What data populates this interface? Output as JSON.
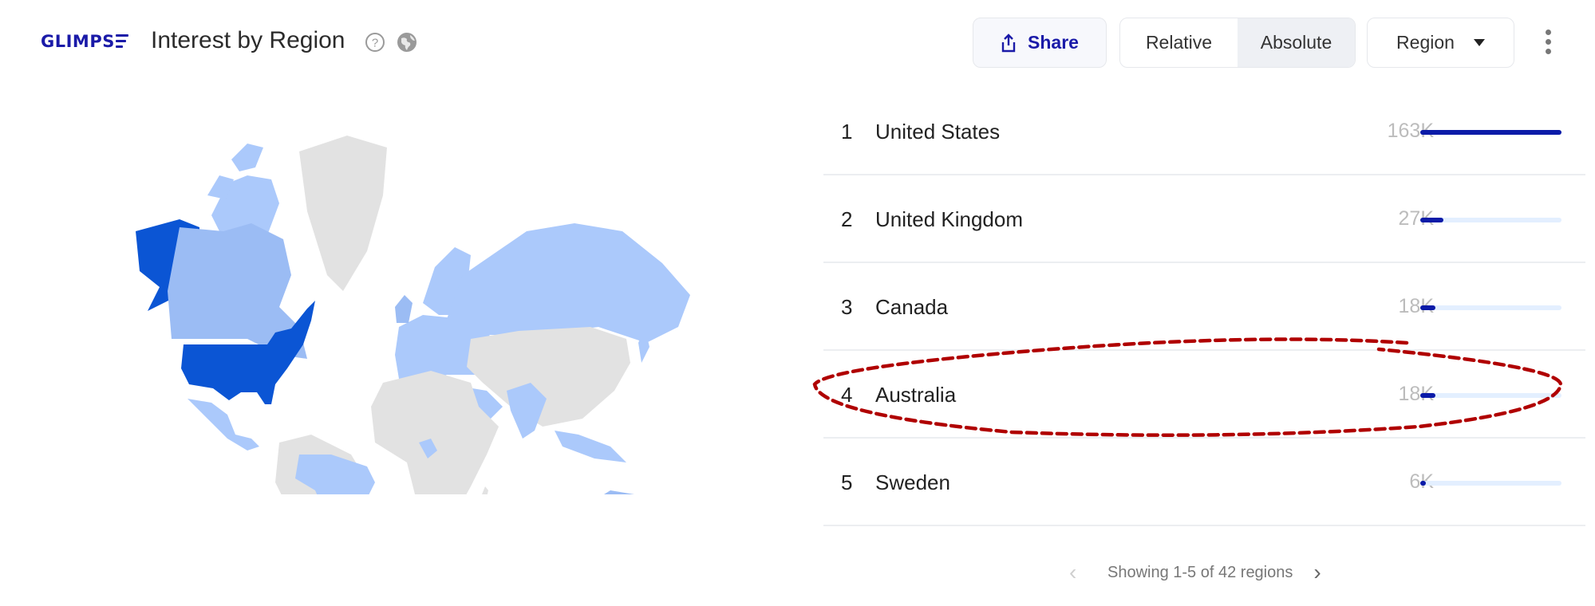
{
  "header": {
    "logo": "GLIMPS",
    "title": "Interest by Region",
    "icons": {
      "help": "help-circle-icon",
      "globe": "globe-icon"
    },
    "share_label": "Share",
    "toggle": {
      "options": [
        "Relative",
        "Absolute"
      ],
      "selected": "Absolute"
    },
    "region_label": "Region",
    "more": "more-vertical-icon"
  },
  "map": {
    "type": "choropleth-world",
    "highlight_color": "#0b55d4",
    "mid_color": "#9bbcf4",
    "light_color": "#abc9fb",
    "no_data_color": "#e2e2e2",
    "highest_region": "United States"
  },
  "regions": {
    "items": [
      {
        "rank": "1",
        "name": "United States",
        "value": "163K",
        "fraction": 1.0
      },
      {
        "rank": "2",
        "name": "United Kingdom",
        "value": "27K",
        "fraction": 0.166
      },
      {
        "rank": "3",
        "name": "Canada",
        "value": "18K",
        "fraction": 0.11
      },
      {
        "rank": "4",
        "name": "Australia",
        "value": "18K",
        "fraction": 0.11
      },
      {
        "rank": "5",
        "name": "Sweden",
        "value": "6K",
        "fraction": 0.037
      }
    ],
    "highlighted": "Australia",
    "bar_color": "#0b1ba8",
    "track_color": "#e3efff"
  },
  "pagination": {
    "label": "Showing 1-5 of 42 regions",
    "prev_icon": "chevron-left-icon",
    "next_icon": "chevron-right-icon"
  },
  "annotation": {
    "color": "#b00000",
    "style": "dashed-ellipse"
  }
}
